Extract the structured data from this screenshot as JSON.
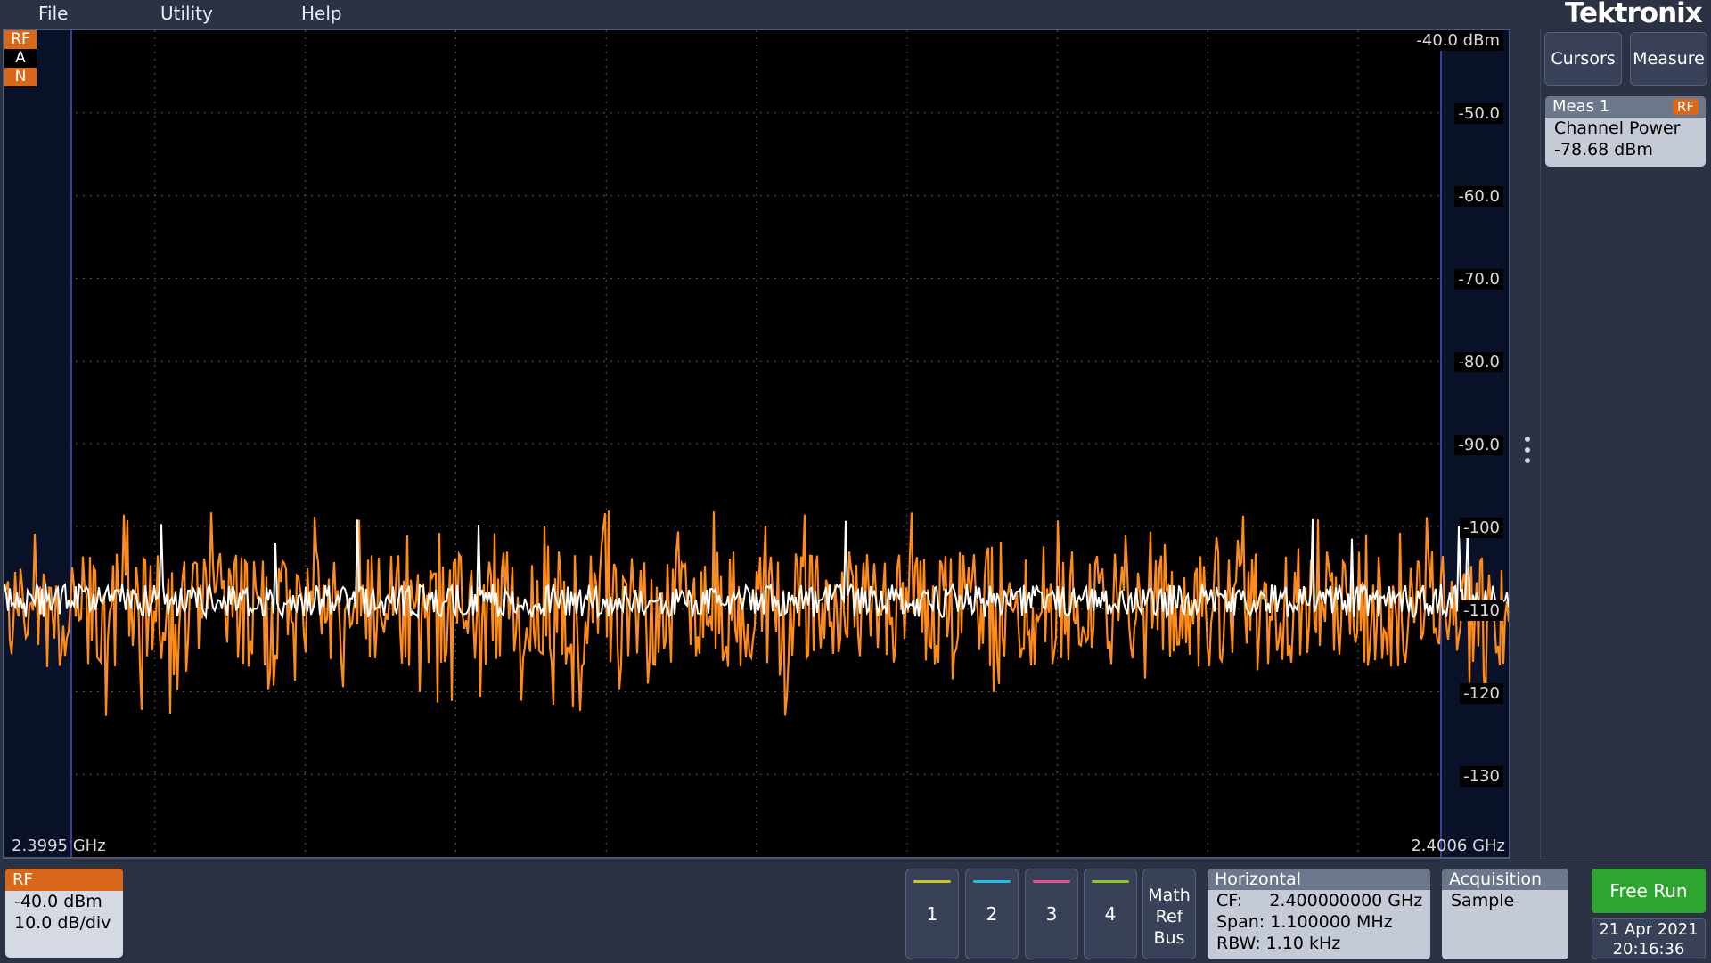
{
  "menu": {
    "file": "File",
    "utility": "Utility",
    "help": "Help"
  },
  "brand": "Tektronix",
  "graticule": {
    "rf_tags": [
      "RF",
      "A",
      "N"
    ],
    "ref_level_label": "-40.0 dBm",
    "y_tick_labels": [
      "-50.0",
      "-60.0",
      "-70.0",
      "-80.0",
      "-90.0",
      "-100",
      "-110",
      "-120",
      "-130"
    ],
    "x_start_label": "2.3995 GHz",
    "x_stop_label": "2.4006 GHz"
  },
  "chart_data": {
    "type": "line",
    "ylim": [
      -140,
      -40
    ],
    "yunit": "dBm",
    "xlim_label": [
      "2.3995 GHz",
      "2.4006 GHz"
    ],
    "grid": true,
    "series": [
      {
        "name": "",
        "color": "#ff8c1a",
        "description_level": "noise floor approx -110 dBm, peaks to -100, dips to -122"
      },
      {
        "name": "",
        "color": "#ffffff",
        "description_level": "average trace approx -109 dBm"
      }
    ]
  },
  "side": {
    "cursors": "Cursors",
    "measure": "Measure",
    "meas_title": "Meas 1",
    "meas_badge": "RF",
    "meas_name": "Channel Power",
    "meas_value": "-78.68 dBm"
  },
  "bottom": {
    "rf_title": "RF",
    "rf_ref": "-40.0 dBm",
    "rf_scale": "10.0 dB/div",
    "channels": [
      {
        "label": "1",
        "color": "#c8c81e"
      },
      {
        "label": "2",
        "color": "#1ebee6"
      },
      {
        "label": "3",
        "color": "#e6508c"
      },
      {
        "label": "4",
        "color": "#8cc81e"
      }
    ],
    "math": "Math",
    "ref": "Ref",
    "bus": "Bus",
    "horizontal_title": "Horizontal",
    "cf": "CF:     2.400000000 GHz",
    "span": "Span: 1.100000 MHz",
    "rbw": "RBW: 1.10 kHz",
    "acquisition_title": "Acquisition",
    "acquisition_mode": "Sample",
    "free_run": "Free Run",
    "date": "21 Apr 2021",
    "time": "20:16:36"
  }
}
